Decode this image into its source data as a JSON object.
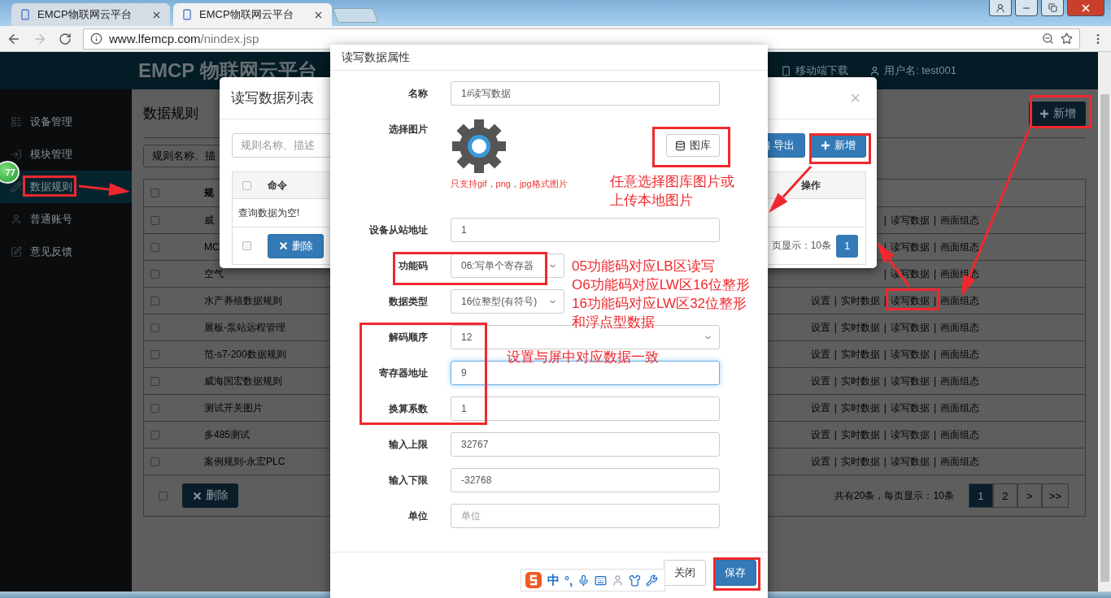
{
  "browser": {
    "tabs": [
      {
        "title": "EMCP物联网云平台",
        "selected": false
      },
      {
        "title": "EMCP物联网云平台",
        "selected": true
      }
    ],
    "url_host": "www.lfemcp.com",
    "url_path": "/nindex.jsp"
  },
  "header": {
    "logo": "EMCP 物联网云平台",
    "mobile": "移动端下载",
    "user": "用户名: test001"
  },
  "sidebar": {
    "badge": "77",
    "items": [
      {
        "label": "设备管理",
        "selected": false
      },
      {
        "label": "模块管理",
        "selected": false
      },
      {
        "label": "数据规则",
        "selected": true
      },
      {
        "label": "普通账号",
        "selected": false
      },
      {
        "label": "意见反馈",
        "selected": false
      }
    ]
  },
  "page": {
    "title": "数据规则",
    "add_button": "新增",
    "search_placeholder": "规则名称、描",
    "header_checked": false,
    "column_1": "规",
    "action_separator": "|",
    "rows": [
      {
        "checked": false,
        "name": "威",
        "actions": [
          "读写数据",
          "画面组态"
        ]
      },
      {
        "checked": false,
        "name": "MC",
        "actions": [
          "读写数据",
          "画面组态"
        ]
      },
      {
        "checked": false,
        "name": "空气",
        "actions": [
          "读写数据",
          "画面组态"
        ]
      },
      {
        "checked": false,
        "name": "水产养殖数据规则",
        "actions": [
          "设置",
          "实时数据",
          "读写数据",
          "画面组态"
        ]
      },
      {
        "checked": false,
        "name": "展板-泵站远程管理",
        "actions": [
          "设置",
          "实时数据",
          "读写数据",
          "画面组态"
        ]
      },
      {
        "checked": false,
        "name": "范-s7-200数据规则",
        "actions": [
          "设置",
          "实时数据",
          "读写数据",
          "画面组态"
        ]
      },
      {
        "checked": false,
        "name": "威海国宏数据规则",
        "actions": [
          "设置",
          "实时数据",
          "读写数据",
          "画面组态"
        ]
      },
      {
        "checked": false,
        "name": "测试开关图片",
        "actions": [
          "设置",
          "实时数据",
          "读写数据",
          "画面组态"
        ]
      },
      {
        "checked": false,
        "name": "多485测试",
        "actions": [
          "设置",
          "实时数据",
          "读写数据",
          "画面组态"
        ]
      },
      {
        "checked": false,
        "name": "案例规则-永宏PLC",
        "actions": [
          "设置",
          "实时数据",
          "读写数据",
          "画面组态"
        ]
      }
    ],
    "footer_checked": false,
    "delete_button": "删除",
    "summary": "共有20条，每页显示：10条",
    "pages": [
      {
        "label": "1",
        "selected": true
      },
      {
        "label": "2",
        "selected": false
      },
      {
        "label": ">",
        "selected": false
      },
      {
        "label": ">>",
        "selected": false
      }
    ]
  },
  "list_dialog": {
    "title": "读写数据列表",
    "close": "×",
    "search_placeholder": "规则名称、描述",
    "export_button": "导出",
    "add_button": "新增",
    "header_checked": false,
    "column_1": "命令",
    "column_2": "操作",
    "empty": "查询数据为空!",
    "footer_checked": false,
    "delete_button": "删除",
    "summary": "页显示：10条",
    "pages": [
      {
        "label": "1",
        "selected": true
      }
    ]
  },
  "form_dialog": {
    "title": "读写数据属性",
    "fields": [
      {
        "kind": "text",
        "label": "名称",
        "value": "1#读写数据"
      },
      {
        "kind": "image",
        "label": "选择图片",
        "button": "图库",
        "note": "只支持gif，png，jpg格式图片"
      },
      {
        "kind": "text",
        "label": "设备从站地址",
        "value": "1"
      },
      {
        "kind": "select",
        "label": "功能码",
        "value": "06:写单个寄存器"
      },
      {
        "kind": "select",
        "label": "数据类型",
        "value": "16位整型(有符号)"
      },
      {
        "kind": "select",
        "label": "解码顺序",
        "value": "12"
      },
      {
        "kind": "text",
        "label": "寄存器地址",
        "value": "9",
        "focused": true
      },
      {
        "kind": "text",
        "label": "换算系数",
        "value": "1"
      },
      {
        "kind": "text",
        "label": "输入上限",
        "value": "32767"
      },
      {
        "kind": "text",
        "label": "输入下限",
        "value": "-32768"
      },
      {
        "kind": "text",
        "label": "单位",
        "placeholder": "单位"
      }
    ],
    "close_button": "关闭",
    "save_button": "保存"
  },
  "annotations": [
    {
      "lines": [
        "任意选择图库图片或",
        "上传本地图片"
      ]
    },
    {
      "lines": [
        "05功能码对应LB区读写",
        "O6功能码对应LW区16位整形",
        "16功能码对应LW区32位整形",
        "和浮点型数据"
      ]
    },
    {
      "lines": [
        "设置与屏中对应数据一致"
      ]
    }
  ],
  "ime_bar": {
    "mode": "中",
    "punctuation": "°,"
  }
}
